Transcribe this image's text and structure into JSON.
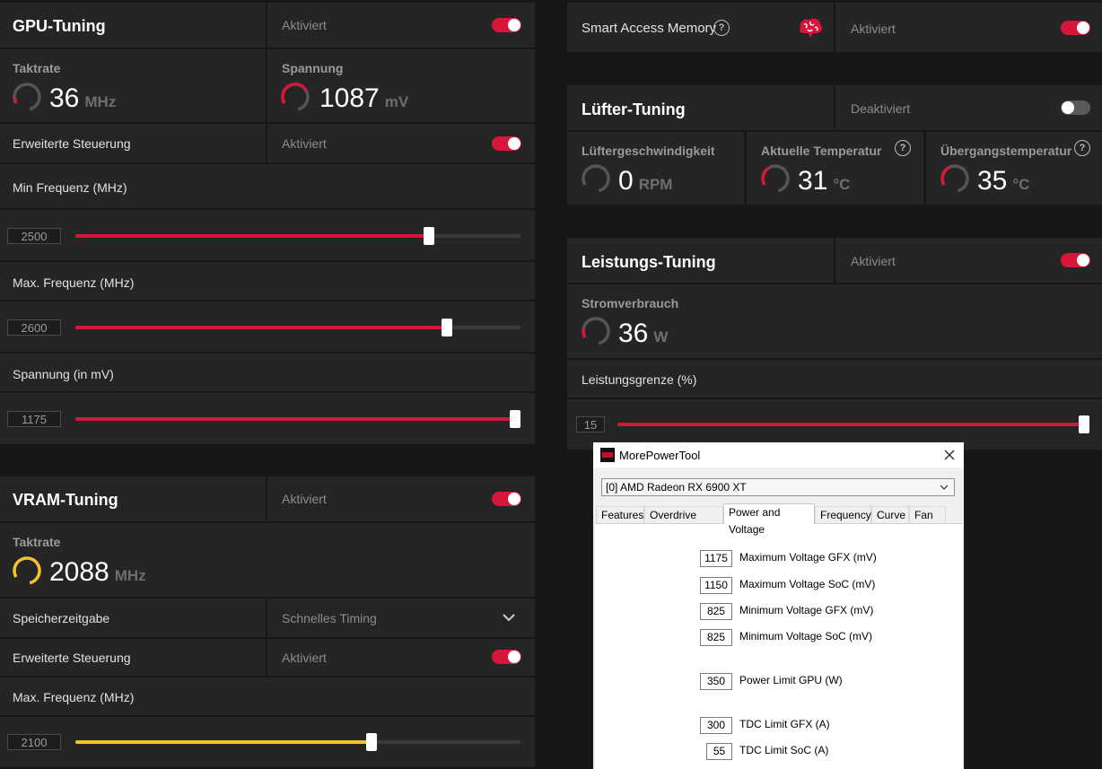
{
  "gpu_tuning": {
    "title": "GPU-Tuning",
    "status": "Aktiviert",
    "enabled": true,
    "clock": {
      "label": "Taktrate",
      "value": "36",
      "unit": "MHz"
    },
    "voltage": {
      "label": "Spannung",
      "value": "1087",
      "unit": "mV"
    },
    "advanced": {
      "label": "Erweiterte Steuerung",
      "status": "Aktiviert",
      "enabled": true
    },
    "min_freq": {
      "label": "Min Frequenz (MHz)",
      "value": "2500",
      "level": 0.795
    },
    "max_freq": {
      "label": "Max. Frequenz (MHz)",
      "value": "2600",
      "level": 0.834
    },
    "voltage_slider": {
      "label": "Spannung (in mV)",
      "value": "1175",
      "level": 1.0
    }
  },
  "vram_tuning": {
    "title": "VRAM-Tuning",
    "status": "Aktiviert",
    "enabled": true,
    "clock": {
      "label": "Taktrate",
      "value": "2088",
      "unit": "MHz"
    },
    "timing": {
      "label": "Speicherzeitgabe",
      "value": "Schnelles Timing"
    },
    "advanced": {
      "label": "Erweiterte Steuerung",
      "status": "Aktiviert",
      "enabled": true
    },
    "max_freq": {
      "label": "Max. Frequenz (MHz)",
      "value": "2100",
      "level": 0.665
    }
  },
  "sam": {
    "label": "Smart Access Memory",
    "status": "Aktiviert",
    "enabled": true
  },
  "fan_tuning": {
    "title": "Lüfter-Tuning",
    "status": "Deaktiviert",
    "enabled": false,
    "speed": {
      "label": "Lüftergeschwindigkeit",
      "value": "0",
      "unit": "RPM"
    },
    "temp": {
      "label": "Aktuelle Temperatur",
      "value": "31",
      "unit": "°C"
    },
    "junction": {
      "label": "Übergangstemperatur",
      "value": "35",
      "unit": "°C"
    }
  },
  "power_tuning": {
    "title": "Leistungs-Tuning",
    "status": "Aktiviert",
    "enabled": true,
    "power": {
      "label": "Stromverbrauch",
      "value": "36",
      "unit": "W"
    },
    "limit": {
      "label": "Leistungsgrenze (%)",
      "value": "15",
      "level": 1.0
    }
  },
  "colors": {
    "accent": "#d6163a",
    "vram_accent": "#f2c230",
    "panel": "#252525",
    "background": "#171717"
  },
  "mpt": {
    "title": "MorePowerTool",
    "device": "[0] AMD Radeon RX 6900 XT",
    "tabs": [
      "Features",
      "Overdrive Limits",
      "Power and Voltage",
      "Frequency",
      "Curve",
      "Fan"
    ],
    "active_tab": "Power and Voltage",
    "fields": [
      {
        "value": "1175",
        "label": "Maximum Voltage GFX (mV)"
      },
      {
        "value": "1150",
        "label": "Maximum Voltage SoC (mV)"
      },
      {
        "value": "825",
        "label": "Minimum Voltage GFX (mV)"
      },
      {
        "value": "825",
        "label": "Minimum Voltage SoC (mV)"
      },
      {
        "value": "350",
        "label": "Power Limit GPU (W)"
      },
      {
        "value": "300",
        "label": "TDC Limit GFX (A)"
      },
      {
        "value": "55",
        "label": "TDC Limit SoC (A)"
      }
    ]
  }
}
